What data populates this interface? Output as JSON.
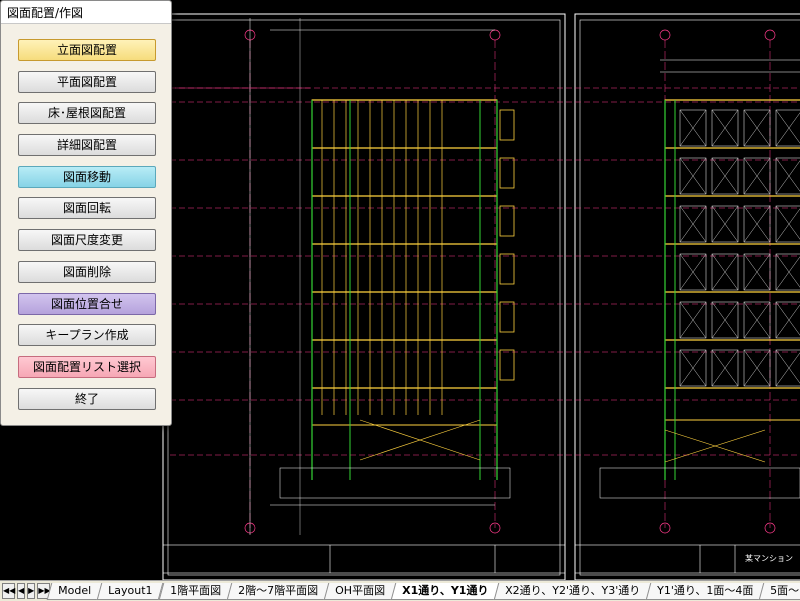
{
  "panel": {
    "title": "図面配置/作図",
    "buttons": [
      {
        "label": "立面図配置",
        "style": "yellow"
      },
      {
        "label": "平面図配置",
        "style": "gray"
      },
      {
        "label": "床･屋根図配置",
        "style": "gray"
      },
      {
        "label": "詳細図配置",
        "style": "gray"
      },
      {
        "label": "図面移動",
        "style": "cyan"
      },
      {
        "label": "図面回転",
        "style": "gray"
      },
      {
        "label": "図面尺度変更",
        "style": "gray"
      },
      {
        "label": "図面削除",
        "style": "gray"
      },
      {
        "label": "図面位置合せ",
        "style": "purple"
      },
      {
        "label": "キープラン作成",
        "style": "gray"
      },
      {
        "label": "図面配置リスト選択",
        "style": "pink"
      },
      {
        "label": "終了",
        "style": "gray"
      }
    ]
  },
  "tabs": [
    {
      "label": "Model",
      "active": false
    },
    {
      "label": "Layout1",
      "active": false
    },
    {
      "label": "1階平面図",
      "active": false
    },
    {
      "label": "2階～7階平面図",
      "active": false
    },
    {
      "label": "OH平面図",
      "active": false
    },
    {
      "label": "X1通り、Y1通り",
      "active": true
    },
    {
      "label": "X2通り、Y2'通り、Y3'通り",
      "active": false
    },
    {
      "label": "Y1'通り、1面～4面",
      "active": false
    },
    {
      "label": "5面～1",
      "active": false
    }
  ],
  "nav": [
    "first-icon",
    "prev-icon",
    "next-icon",
    "last-icon"
  ],
  "drawing": {
    "title_block_text": "某マンション",
    "colors": {
      "frame": "#ffffff",
      "grid": "#ff3b8c",
      "structure": "#ffd23f",
      "green": "#35d435",
      "cyan": "#3ad3e0"
    }
  }
}
